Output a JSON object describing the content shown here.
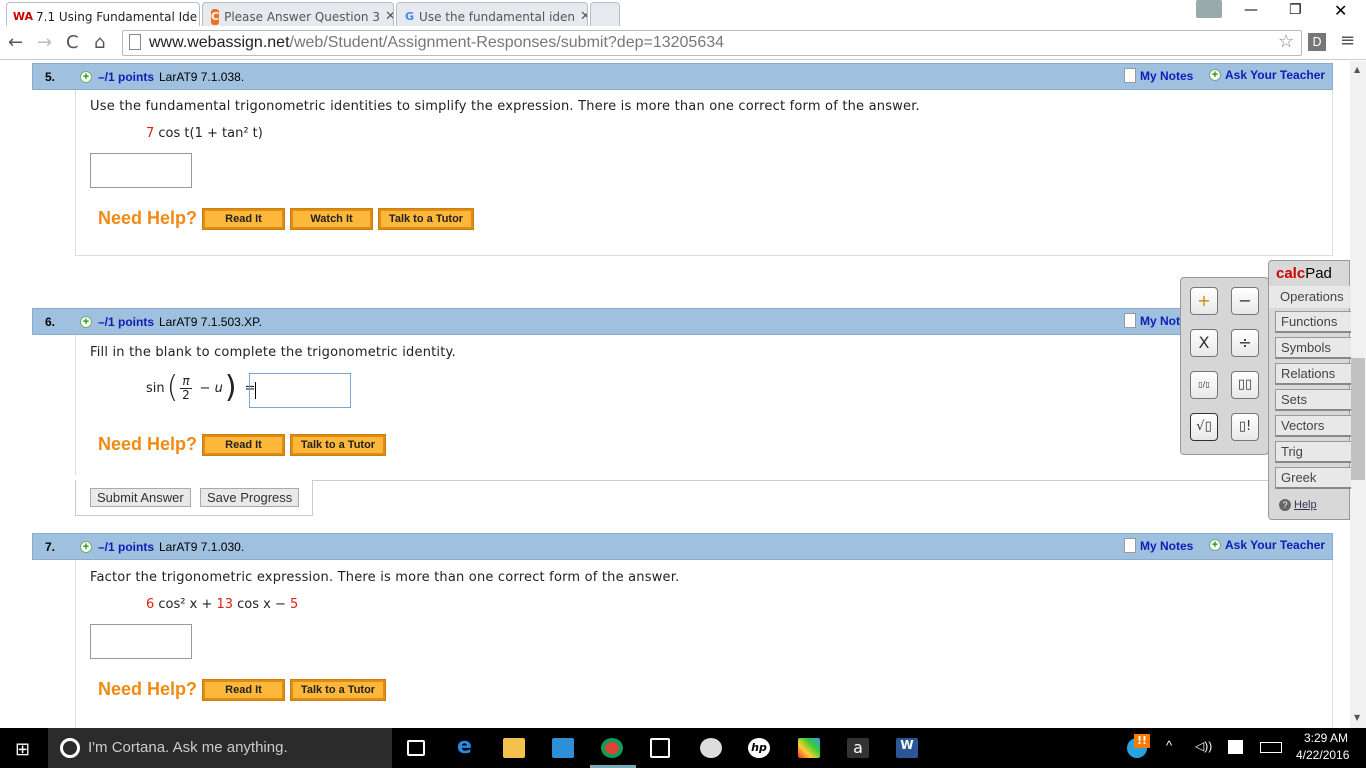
{
  "browser": {
    "tabs": [
      {
        "title": "7.1 Using Fundamental Ide",
        "icon": "webassign-icon",
        "active": true
      },
      {
        "title": "Please Answer Question 3",
        "icon": "chegg-icon",
        "active": false
      },
      {
        "title": "Use the fundamental iden",
        "icon": "google-icon",
        "active": false
      }
    ],
    "url_domain": "www.webassign.net",
    "url_path": "/web/Student/Assignment-Responses/submit?dep=13205634",
    "ext_label": "D"
  },
  "questions": [
    {
      "num": "5.",
      "points": "–/1 points",
      "code": "LarAT9 7.1.038.",
      "my_notes": "My Notes",
      "ask_teacher": "Ask Your Teacher",
      "prompt": "Use the fundamental trigonometric identities to simplify the expression. There is more than one correct form of the answer.",
      "expr": {
        "coef": "7",
        "rest": " cos t(1 + tan² t)"
      },
      "answer": "",
      "help": [
        "Read It",
        "Watch It",
        "Talk to a Tutor"
      ]
    },
    {
      "num": "6.",
      "points": "–/1 points",
      "code": "LarAT9 7.1.503.XP.",
      "my_notes": "My Notes",
      "prompt": "Fill in the blank to complete the trigonometric identity.",
      "expr": {
        "fn": "sin",
        "num": "π",
        "den": "2",
        "minus": "− u",
        "eq": "="
      },
      "answer": "",
      "help": [
        "Read It",
        "Talk to a Tutor"
      ]
    },
    {
      "num": "7.",
      "points": "–/1 points",
      "code": "LarAT9 7.1.030.",
      "my_notes": "My Notes",
      "ask_teacher": "Ask Your Teacher",
      "prompt": "Factor the trigonometric expression. There is more than one correct form of the answer.",
      "expr": {
        "c1": "6",
        "p1": " cos² x + ",
        "c2": "13",
        "p2": " cos x − ",
        "c3": "5"
      },
      "answer": "",
      "help": [
        "Read It",
        "Talk to a Tutor"
      ]
    }
  ],
  "need_help": "Need Help?",
  "submit_label": "Submit Answer",
  "save_label": "Save Progress",
  "calcpad": {
    "title_a": "calc",
    "title_b": "Pad",
    "active": "Operations",
    "menu": [
      "Functions",
      "Symbols",
      "Relations",
      "Sets",
      "Vectors",
      "Trig",
      "Greek"
    ],
    "help": "Help",
    "keys": [
      "+",
      "−",
      "X",
      "÷",
      "▯/▯",
      "▯▯",
      "√▯",
      "▯!"
    ]
  },
  "taskbar": {
    "cortana": "I'm Cortana. Ask me anything.",
    "time": "3:29 AM",
    "date": "4/22/2016"
  },
  "colors": {
    "header": "#9fc0de",
    "points": "#0a1fb5",
    "help_orange": "#f08a12",
    "button_orange": "#fdb83b",
    "red_number": "#d21111"
  }
}
